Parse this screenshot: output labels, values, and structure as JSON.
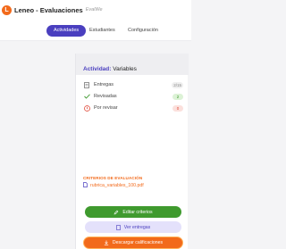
{
  "header": {
    "logo_letter": "L",
    "app_name": "Leneo - Evaluaciones",
    "app_subtitle": "EvalWe"
  },
  "tabs": [
    {
      "label": "Actividades",
      "active": true
    },
    {
      "label": "Estudiantes",
      "active": false
    },
    {
      "label": "Configuración",
      "active": false
    }
  ],
  "activity": {
    "title_prefix": "Actividad:",
    "title_value": "Variables"
  },
  "stats": [
    {
      "icon": "document-icon",
      "label": "Entregas",
      "count": "2/15"
    },
    {
      "icon": "check-icon",
      "label": "Revisadas",
      "count": "2"
    },
    {
      "icon": "alert-icon",
      "label": "Por revisar",
      "count": "0"
    }
  ],
  "criteria": {
    "title": "CRITERIOS DE EVALUACIÓN",
    "file": "rubrica_variables_100.pdf"
  },
  "actions": {
    "edit": "Editar criterios",
    "view": "Ver entregas",
    "download": "Descargar calificaciones"
  },
  "colors": {
    "brand": "#f26a1b",
    "accent": "#4a3fbf",
    "success": "#3f9a2e"
  }
}
